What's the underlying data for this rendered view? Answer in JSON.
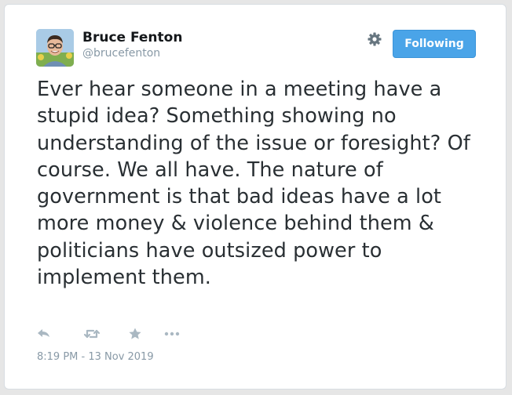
{
  "user": {
    "name": "Bruce Fenton",
    "handle": "@brucefenton"
  },
  "header": {
    "settings_icon": "gear-icon",
    "follow_button_label": "Following"
  },
  "tweet": {
    "text": "Ever hear someone in a meeting have a stupid idea? Something showing no understanding of the issue or foresight? Of course. We all have. The nature of government is that bad ideas have a lot more money & violence behind them & politicians have outsized power to implement them.",
    "timestamp": "8:19 PM - 13 Nov 2019"
  },
  "actions": {
    "icons": [
      "reply-icon",
      "retweet-icon",
      "like-icon",
      "more-icon"
    ]
  },
  "colors": {
    "button": "#4aa4e8",
    "text": "#292f33",
    "muted": "#8899a6",
    "icon": "#aab8c2"
  }
}
